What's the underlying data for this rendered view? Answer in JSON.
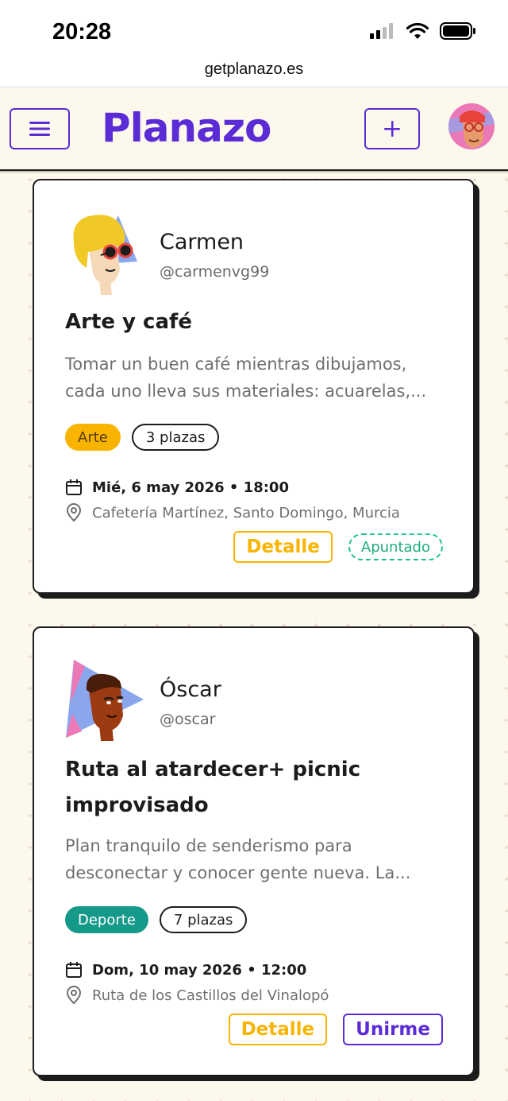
{
  "status": {
    "time": "20:28",
    "url": "getplanazo.es"
  },
  "header": {
    "logo": "Planazo",
    "menu_icon": "hamburger-icon",
    "add_icon": "plus-icon"
  },
  "colors": {
    "brand": "#5b2bd6",
    "detail": "#f8b400",
    "art": "#f8b400",
    "sport": "#159a8a",
    "joined": "#1fc28e"
  },
  "plans": [
    {
      "user_name": "Carmen",
      "user_handle": "@carmenvg99",
      "title": "Arte y café",
      "description": "Tomar un buen café mientras dibujamos, cada uno lleva sus materiales: acuarelas,...",
      "category": "Arte",
      "seats": "3 plazas",
      "date": "Mié, 6 may 2026 • 18:00",
      "location": "Cafetería Martínez, Santo Domingo, Murcia",
      "detail_label": "Detalle",
      "status_label": "Apuntado"
    },
    {
      "user_name": "Óscar",
      "user_handle": "@oscar",
      "title": "Ruta al atardecer+ picnic improvisado",
      "description": "Plan tranquilo de senderismo para desconectar y conocer gente nueva. La...",
      "category": "Deporte",
      "seats": "7 plazas",
      "date": "Dom, 10 may 2026 • 12:00",
      "location": "Ruta de los Castillos del Vinalopó",
      "detail_label": "Detalle",
      "join_label": "Unirme"
    }
  ]
}
